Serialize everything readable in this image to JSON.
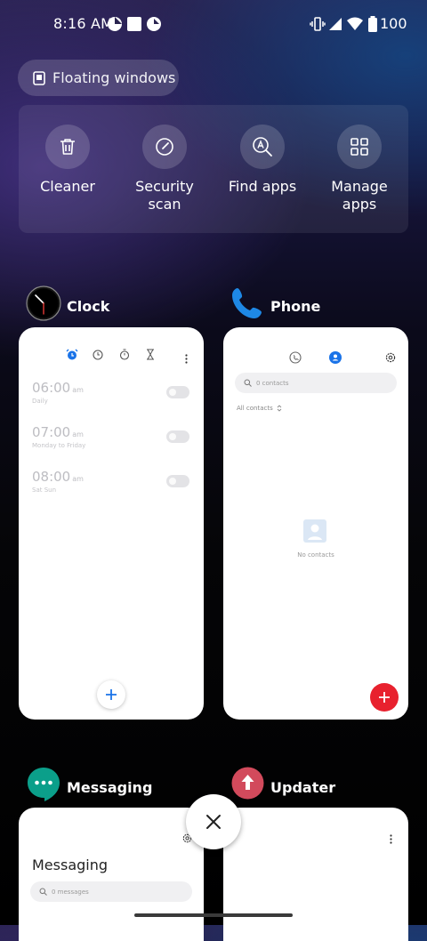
{
  "status_bar": {
    "time": "8:16 AM",
    "battery": "100"
  },
  "floating_windows": {
    "label": "Floating windows"
  },
  "quick_actions": [
    {
      "label": "Cleaner",
      "icon": "trash-icon"
    },
    {
      "label": "Security scan",
      "icon": "security-scan-icon"
    },
    {
      "label": "Find apps",
      "icon": "find-apps-icon"
    },
    {
      "label": "Manage apps",
      "icon": "grid-icon"
    }
  ],
  "apps": {
    "clock": {
      "name": "Clock",
      "alarms": [
        {
          "time": "06:00",
          "ampm": "am",
          "repeat": "Daily"
        },
        {
          "time": "07:00",
          "ampm": "am",
          "repeat": "Monday to Friday"
        },
        {
          "time": "08:00",
          "ampm": "am",
          "repeat": "Sat Sun"
        }
      ]
    },
    "phone": {
      "name": "Phone",
      "search_placeholder": "0 contacts",
      "filter": "All contacts",
      "empty": "No contacts"
    },
    "messaging": {
      "name": "Messaging",
      "title": "Messaging",
      "search_placeholder": "0 messages"
    },
    "updater": {
      "name": "Updater"
    }
  },
  "colors": {
    "accent_blue": "#1a73e8",
    "fab_red": "#e8212e",
    "messaging_teal": "#0b9f8a",
    "updater_red": "#d24a5c"
  }
}
